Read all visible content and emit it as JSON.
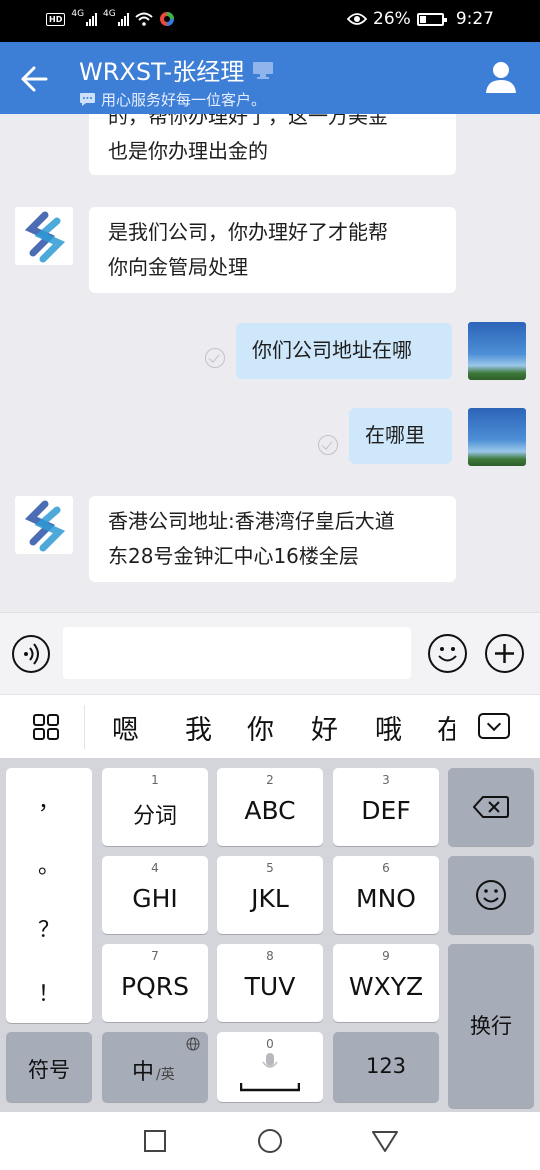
{
  "status_bar": {
    "network_left": "HD",
    "network_4g_1": "4G",
    "network_4g_2": "4G",
    "battery_pct": "26%",
    "time": "9:27"
  },
  "header": {
    "title": "WRXST-张经理",
    "subtitle": "用心服务好每一位客户。"
  },
  "messages": [
    {
      "side": "left",
      "lines": [
        "的，帮你办理好了，这一万美金",
        "也是你办理出金的"
      ]
    },
    {
      "side": "left",
      "lines": [
        "是我们公司，你办理好了才能帮",
        "你向金管局处理"
      ]
    },
    {
      "side": "right",
      "lines": [
        "你们公司地址在哪"
      ]
    },
    {
      "side": "right",
      "lines": [
        "在哪里"
      ]
    },
    {
      "side": "left",
      "lines": [
        "香港公司地址:香港湾仔皇后大道",
        "东28号金钟汇中心16楼全层"
      ]
    }
  ],
  "input": {
    "placeholder": ""
  },
  "candidates": [
    "嗯",
    "我",
    "你",
    "好",
    "哦",
    "在"
  ],
  "keyboard": {
    "punct": [
      "，",
      "。",
      "？",
      "！"
    ],
    "keys": [
      {
        "num": "1",
        "label": "分词"
      },
      {
        "num": "2",
        "label": "ABC"
      },
      {
        "num": "3",
        "label": "DEF"
      },
      {
        "num": "4",
        "label": "GHI"
      },
      {
        "num": "5",
        "label": "JKL"
      },
      {
        "num": "6",
        "label": "MNO"
      },
      {
        "num": "7",
        "label": "PQRS"
      },
      {
        "num": "8",
        "label": "TUV"
      },
      {
        "num": "9",
        "label": "WXYZ"
      }
    ],
    "symbols": "符号",
    "lang_main": "中",
    "lang_sub": "/英",
    "space_num": "0",
    "numbers": "123",
    "enter": "换行"
  }
}
